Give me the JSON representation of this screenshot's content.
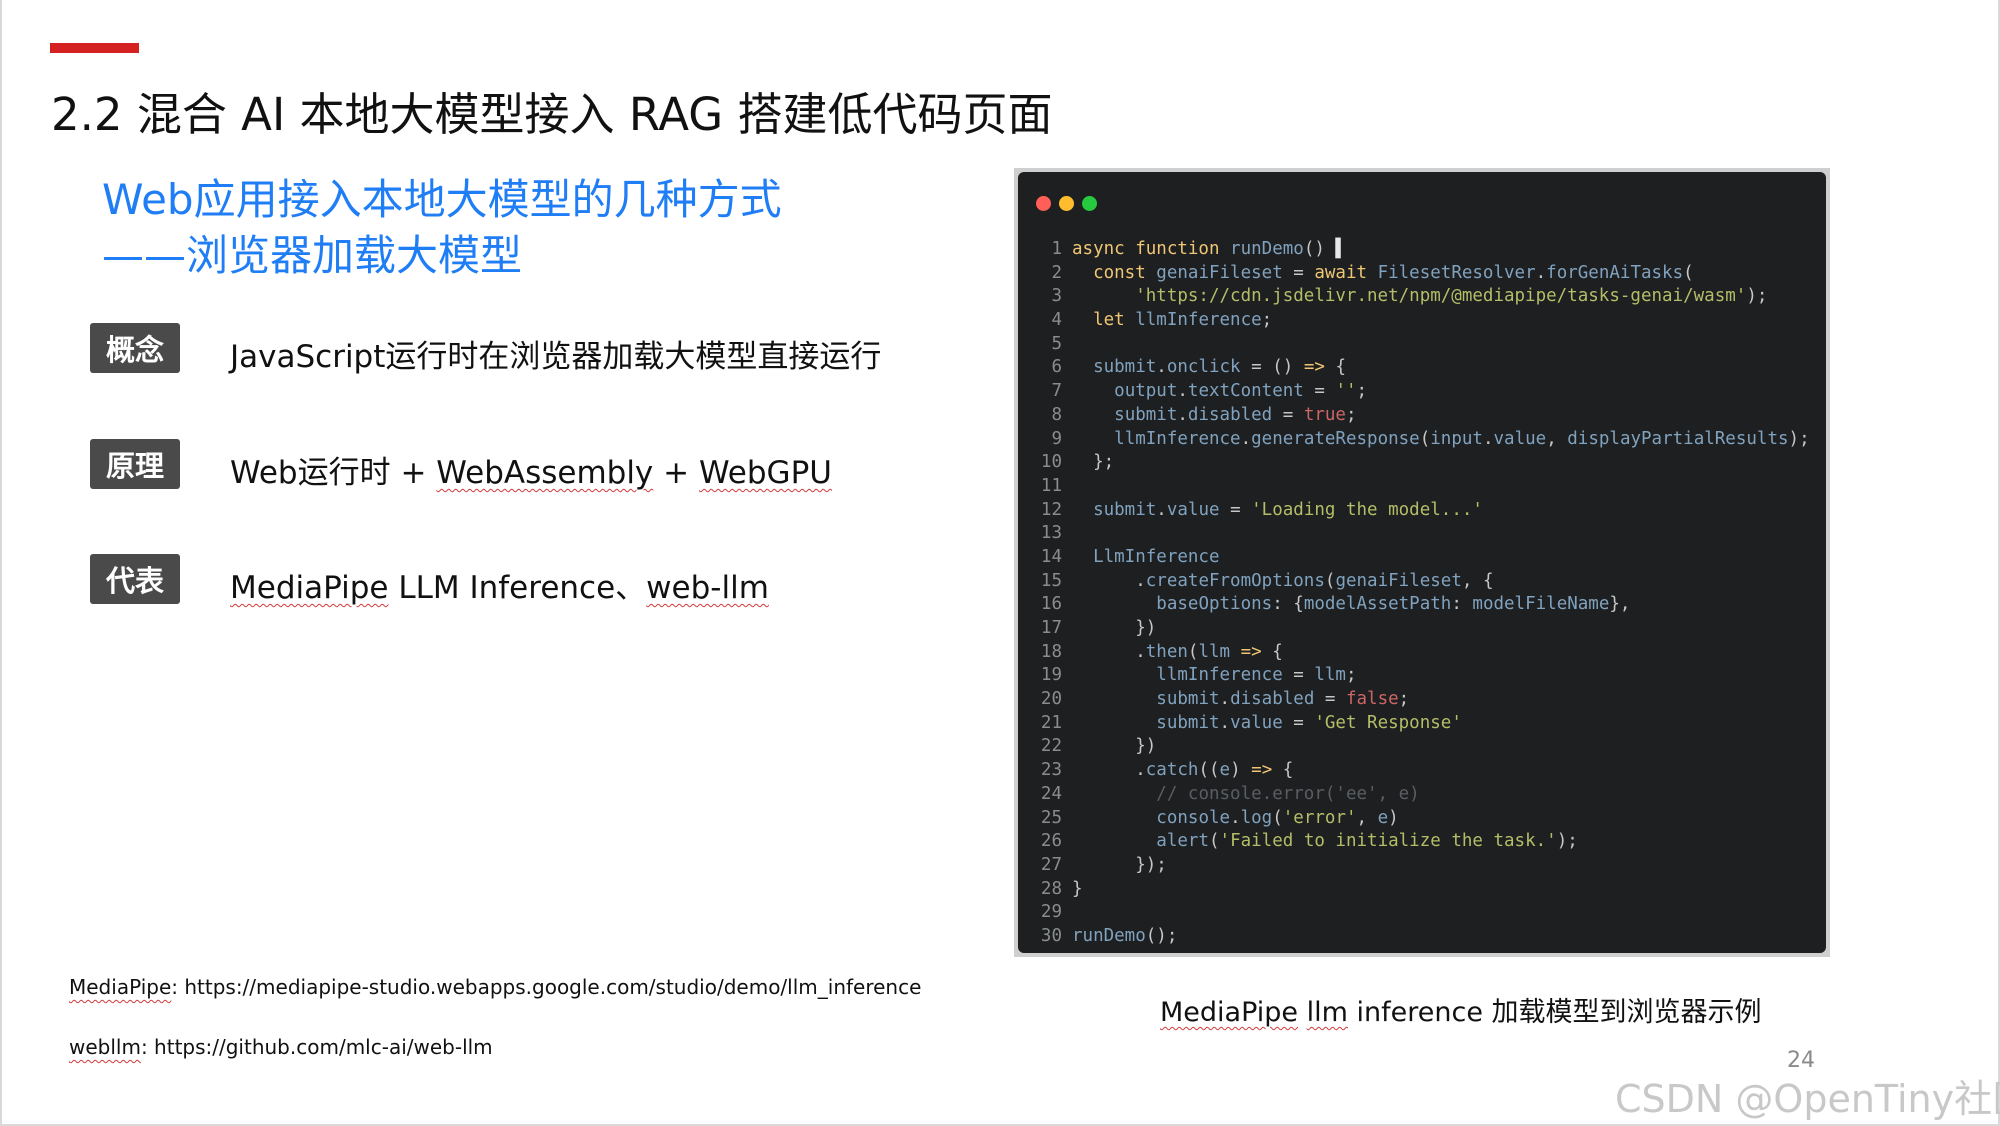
{
  "slide": {
    "title": "2.2 混合 AI 本地大模型接入 RAG 搭建低代码页面",
    "subtitle_line1": "Web应用接入本地大模型的几种方式",
    "subtitle_line2": "——浏览器加载大模型",
    "page_number": "24",
    "accent_color": "#d42222",
    "subtitle_color": "#1f7ef5"
  },
  "items": [
    {
      "tag": "概念",
      "description": "JavaScript运行时在浏览器加载大模型直接运行"
    },
    {
      "tag": "原理",
      "desc_a": "Web运行时 + ",
      "desc_b": "WebAssembly",
      "desc_c": " + ",
      "desc_d": "WebGPU"
    },
    {
      "tag": "代表",
      "desc_a": "MediaPipe",
      "desc_b": " LLM Inference、",
      "desc_c": "web-llm"
    }
  ],
  "footnotes": [
    {
      "label": "MediaPipe",
      "rest": ": https://mediapipe-studio.webapps.google.com/studio/demo/llm_inference"
    },
    {
      "label": "webllm",
      "rest": ":  https://github.com/mlc-ai/web-llm"
    }
  ],
  "code_window": {
    "dot_colors": [
      "#ff5f56",
      "#ffbd2e",
      "#27c93f"
    ],
    "lines": [
      [
        [
          "kw",
          "async "
        ],
        [
          "kw",
          "function "
        ],
        [
          "fn",
          "runDemo"
        ],
        [
          "p",
          "() "
        ],
        [
          "cur",
          "▌"
        ]
      ],
      [
        [
          "p",
          "  "
        ],
        [
          "kw",
          "const "
        ],
        [
          "v",
          "genaiFileset"
        ],
        [
          "p",
          " = "
        ],
        [
          "kw",
          "await "
        ],
        [
          "v",
          "FilesetResolver"
        ],
        [
          "p",
          "."
        ],
        [
          "fn",
          "forGenAiTasks"
        ],
        [
          "p",
          "("
        ]
      ],
      [
        [
          "p",
          "      "
        ],
        [
          "s",
          "'https://cdn.jsdelivr.net/npm/@mediapipe/tasks-genai/wasm'"
        ],
        [
          "p",
          ");"
        ]
      ],
      [
        [
          "p",
          "  "
        ],
        [
          "kw",
          "let "
        ],
        [
          "v",
          "llmInference"
        ],
        [
          "p",
          ";"
        ]
      ],
      [],
      [
        [
          "p",
          "  "
        ],
        [
          "v",
          "submit"
        ],
        [
          "p",
          "."
        ],
        [
          "fn",
          "onclick"
        ],
        [
          "p",
          " = () "
        ],
        [
          "kw",
          "=>"
        ],
        [
          "p",
          " {"
        ]
      ],
      [
        [
          "p",
          "    "
        ],
        [
          "v",
          "output"
        ],
        [
          "p",
          "."
        ],
        [
          "v",
          "textContent"
        ],
        [
          "p",
          " = "
        ],
        [
          "s",
          "''"
        ],
        [
          "p",
          ";"
        ]
      ],
      [
        [
          "p",
          "    "
        ],
        [
          "v",
          "submit"
        ],
        [
          "p",
          "."
        ],
        [
          "v",
          "disabled"
        ],
        [
          "p",
          " = "
        ],
        [
          "b",
          "true"
        ],
        [
          "p",
          ";"
        ]
      ],
      [
        [
          "p",
          "    "
        ],
        [
          "v",
          "llmInference"
        ],
        [
          "p",
          "."
        ],
        [
          "fn",
          "generateResponse"
        ],
        [
          "p",
          "("
        ],
        [
          "v",
          "input"
        ],
        [
          "p",
          "."
        ],
        [
          "v",
          "value"
        ],
        [
          "p",
          ", "
        ],
        [
          "v",
          "displayPartialResults"
        ],
        [
          "p",
          ");"
        ]
      ],
      [
        [
          "p",
          "  };"
        ]
      ],
      [],
      [
        [
          "p",
          "  "
        ],
        [
          "v",
          "submit"
        ],
        [
          "p",
          "."
        ],
        [
          "v",
          "value"
        ],
        [
          "p",
          " = "
        ],
        [
          "s",
          "'Loading the model...'"
        ]
      ],
      [],
      [
        [
          "p",
          "  "
        ],
        [
          "v",
          "LlmInference"
        ]
      ],
      [
        [
          "p",
          "      ."
        ],
        [
          "fn",
          "createFromOptions"
        ],
        [
          "p",
          "("
        ],
        [
          "v",
          "genaiFileset"
        ],
        [
          "p",
          ", {"
        ]
      ],
      [
        [
          "p",
          "        "
        ],
        [
          "v",
          "baseOptions"
        ],
        [
          "p",
          ": {"
        ],
        [
          "v",
          "modelAssetPath"
        ],
        [
          "p",
          ": "
        ],
        [
          "v",
          "modelFileName"
        ],
        [
          "p",
          "},"
        ]
      ],
      [
        [
          "p",
          "      })"
        ]
      ],
      [
        [
          "p",
          "      ."
        ],
        [
          "fn",
          "then"
        ],
        [
          "p",
          "("
        ],
        [
          "v",
          "llm"
        ],
        [
          "p",
          " "
        ],
        [
          "kw",
          "=>"
        ],
        [
          "p",
          " {"
        ]
      ],
      [
        [
          "p",
          "        "
        ],
        [
          "v",
          "llmInference"
        ],
        [
          "p",
          " = "
        ],
        [
          "v",
          "llm"
        ],
        [
          "p",
          ";"
        ]
      ],
      [
        [
          "p",
          "        "
        ],
        [
          "v",
          "submit"
        ],
        [
          "p",
          "."
        ],
        [
          "v",
          "disabled"
        ],
        [
          "p",
          " = "
        ],
        [
          "b",
          "false"
        ],
        [
          "p",
          ";"
        ]
      ],
      [
        [
          "p",
          "        "
        ],
        [
          "v",
          "submit"
        ],
        [
          "p",
          "."
        ],
        [
          "v",
          "value"
        ],
        [
          "p",
          " = "
        ],
        [
          "s",
          "'Get Response'"
        ]
      ],
      [
        [
          "p",
          "      })"
        ]
      ],
      [
        [
          "p",
          "      ."
        ],
        [
          "fn",
          "catch"
        ],
        [
          "p",
          "(("
        ],
        [
          "v",
          "e"
        ],
        [
          "p",
          ") "
        ],
        [
          "kw",
          "=>"
        ],
        [
          "p",
          " {"
        ]
      ],
      [
        [
          "p",
          "        "
        ],
        [
          "c",
          "// console.error('ee', e)"
        ]
      ],
      [
        [
          "p",
          "        "
        ],
        [
          "v",
          "console"
        ],
        [
          "p",
          "."
        ],
        [
          "fn",
          "log"
        ],
        [
          "p",
          "("
        ],
        [
          "s",
          "'error'"
        ],
        [
          "p",
          ", "
        ],
        [
          "v",
          "e"
        ],
        [
          "p",
          ")"
        ]
      ],
      [
        [
          "p",
          "        "
        ],
        [
          "fn",
          "alert"
        ],
        [
          "p",
          "("
        ],
        [
          "s",
          "'Failed to initialize the task.'"
        ],
        [
          "p",
          ");"
        ]
      ],
      [
        [
          "p",
          "      });"
        ]
      ],
      [
        [
          "p",
          "}"
        ]
      ],
      [],
      [
        [
          "fn",
          "runDemo"
        ],
        [
          "p",
          "();"
        ]
      ]
    ]
  },
  "caption_a": "MediaPipe",
  "caption_b": " ",
  "caption_c": "llm",
  "caption_d": " inference 加载模型到浏览器示例",
  "watermark": "CSDN @OpenTiny社区"
}
